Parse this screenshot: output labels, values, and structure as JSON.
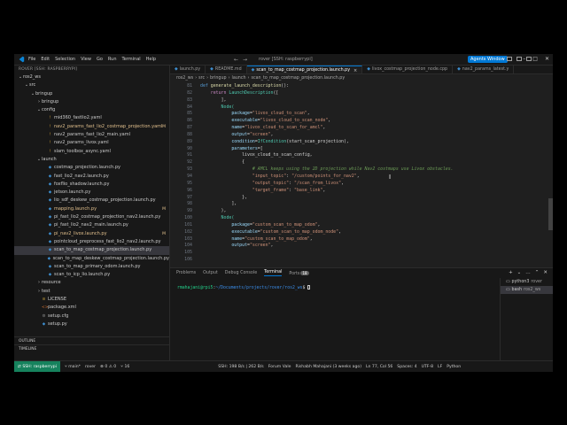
{
  "titlebar": {
    "menu": [
      "File",
      "Edit",
      "Selection",
      "View",
      "Go",
      "Run",
      "Terminal",
      "Help"
    ],
    "title": "rover [SSH: raspberrypi]",
    "agents_label": "Agents Window"
  },
  "sidebar": {
    "header": "ROVER [SSH: RASPBERRYPI]",
    "items": [
      {
        "label": "ros2_ws",
        "depth": 0,
        "chev": "⌄",
        "kind": "folder"
      },
      {
        "label": "src",
        "depth": 1,
        "chev": "⌄",
        "kind": "folder"
      },
      {
        "label": "bringup",
        "depth": 2,
        "chev": "⌄",
        "kind": "folder"
      },
      {
        "label": "bringup",
        "depth": 3,
        "chev": "›",
        "kind": "folder"
      },
      {
        "label": "config",
        "depth": 3,
        "chev": "⌄",
        "kind": "folder"
      },
      {
        "label": "mid360_fastlio2.yaml",
        "depth": 4,
        "kind": "yaml"
      },
      {
        "label": "nav2_params_fast_lio2_costmap_projection.yaml",
        "depth": 4,
        "kind": "yaml",
        "mod": "M"
      },
      {
        "label": "nav2_params_fast_lio2_main.yaml",
        "depth": 4,
        "kind": "yaml"
      },
      {
        "label": "nav2_params_livox.yaml",
        "depth": 4,
        "kind": "yaml"
      },
      {
        "label": "slam_toolbox_async.yaml",
        "depth": 4,
        "kind": "yaml"
      },
      {
        "label": "launch",
        "depth": 3,
        "chev": "⌄",
        "kind": "folder"
      },
      {
        "label": "costmap_projection.launch.py",
        "depth": 4,
        "kind": "py"
      },
      {
        "label": "fast_lio2_nav2.launch.py",
        "depth": 4,
        "kind": "py"
      },
      {
        "label": "foxflio_shadow.launch.py",
        "depth": 4,
        "kind": "py"
      },
      {
        "label": "jetson.launch.py",
        "depth": 4,
        "kind": "py"
      },
      {
        "label": "lio_sdf_deskew_costmap_projection.launch.py",
        "depth": 4,
        "kind": "py"
      },
      {
        "label": "mapping.launch.py",
        "depth": 4,
        "kind": "py",
        "mod": "M"
      },
      {
        "label": "pi_fast_lio2_costmap_projection_nav2.launch.py",
        "depth": 4,
        "kind": "py"
      },
      {
        "label": "pi_fast_lio2_nav2_main.launch.py",
        "depth": 4,
        "kind": "py"
      },
      {
        "label": "pi_nav2_livox.launch.py",
        "depth": 4,
        "kind": "py",
        "mod": "M"
      },
      {
        "label": "pointcloud_preprocess_fast_lio2_nav2.launch.py",
        "depth": 4,
        "kind": "py"
      },
      {
        "label": "scan_to_map_costmap_projection.launch.py",
        "depth": 4,
        "kind": "py",
        "selected": true
      },
      {
        "label": "scan_to_map_deskew_costmap_projection.launch.py",
        "depth": 4,
        "kind": "py"
      },
      {
        "label": "scan_to_map_primary_odom.launch.py",
        "depth": 4,
        "kind": "py"
      },
      {
        "label": "scan_to_icp_lio.launch.py",
        "depth": 4,
        "kind": "py"
      },
      {
        "label": "resource",
        "depth": 3,
        "chev": "›",
        "kind": "folder"
      },
      {
        "label": "test",
        "depth": 3,
        "chev": "›",
        "kind": "folder"
      },
      {
        "label": "LICENSE",
        "depth": 3,
        "kind": "txt"
      },
      {
        "label": "package.xml",
        "depth": 3,
        "kind": "xml"
      },
      {
        "label": "setup.cfg",
        "depth": 3,
        "kind": "cfg"
      },
      {
        "label": "setup.py",
        "depth": 3,
        "kind": "py"
      }
    ],
    "footer": [
      "OUTLINE",
      "TIMELINE"
    ]
  },
  "editor": {
    "tabs": [
      {
        "label": "launch.py",
        "active": false
      },
      {
        "label": "README.md",
        "active": false
      },
      {
        "label": "scan_to_map_costmap_projection.launch.py",
        "active": true
      },
      {
        "label": "livox_costmap_projection_node.cpp",
        "active": false
      },
      {
        "label": "nav2_params_latest.y",
        "active": false
      }
    ],
    "breadcrumb": [
      "ros2_ws",
      "src",
      "bringup",
      "launch",
      "scan_to_map_costmap_projection.launch.py"
    ],
    "line_numbers": [
      "81",
      "82",
      "83",
      "84",
      "85",
      "86",
      "87",
      "88",
      "89",
      "90",
      "91",
      "92",
      "93",
      "94",
      "95",
      "96",
      "97",
      "98",
      "99",
      "100",
      "101",
      "102",
      "103",
      "104",
      "105",
      "106"
    ],
    "lines": [
      [
        {
          "t": "def ",
          "c": "k"
        },
        {
          "t": "generate_launch_description",
          "c": "f"
        },
        {
          "t": "():",
          "c": ""
        }
      ],
      [
        {
          "t": "    return ",
          "c": "kw"
        },
        {
          "t": "LaunchDescription",
          "c": "cls"
        },
        {
          "t": "([",
          "c": ""
        }
      ],
      [
        {
          "t": "        ],",
          "c": ""
        }
      ],
      [
        {
          "t": "        Node(",
          "c": "cls"
        }
      ],
      [
        {
          "t": "            package",
          "c": "p"
        },
        {
          "t": "=",
          "c": ""
        },
        {
          "t": "\"livox_cloud_to_scan\"",
          "c": "s"
        },
        {
          "t": ",",
          "c": ""
        }
      ],
      [
        {
          "t": "            executable",
          "c": "p"
        },
        {
          "t": "=",
          "c": ""
        },
        {
          "t": "\"livox_cloud_to_scan_node\"",
          "c": "s"
        },
        {
          "t": ",",
          "c": ""
        }
      ],
      [
        {
          "t": "            name",
          "c": "p"
        },
        {
          "t": "=",
          "c": ""
        },
        {
          "t": "\"livox_cloud_to_scan_for_amcl\"",
          "c": "s"
        },
        {
          "t": ",",
          "c": ""
        }
      ],
      [
        {
          "t": "            output",
          "c": "p"
        },
        {
          "t": "=",
          "c": ""
        },
        {
          "t": "\"screen\"",
          "c": "s"
        },
        {
          "t": ",",
          "c": ""
        }
      ],
      [
        {
          "t": "            condition",
          "c": "p"
        },
        {
          "t": "=",
          "c": ""
        },
        {
          "t": "IfCondition",
          "c": "cls"
        },
        {
          "t": "(start_scan_projection),",
          "c": ""
        }
      ],
      [
        {
          "t": "            parameters",
          "c": "p"
        },
        {
          "t": "=[",
          "c": ""
        }
      ],
      [
        {
          "t": "                livox_cloud_to_scan_config,",
          "c": ""
        }
      ],
      [
        {
          "t": "                {",
          "c": ""
        }
      ],
      [
        {
          "t": "                    # AMCL keeps using the 2D projection while Nav2 costmaps use Livox obstacles.",
          "c": "c"
        }
      ],
      [
        {
          "t": "                    \"input_topic\"",
          "c": "s"
        },
        {
          "t": ": ",
          "c": ""
        },
        {
          "t": "\"/custom/points_for_nav2\"",
          "c": "s"
        },
        {
          "t": ",",
          "c": ""
        }
      ],
      [
        {
          "t": "                    \"output_topic\"",
          "c": "s"
        },
        {
          "t": ": ",
          "c": ""
        },
        {
          "t": "\"/scan_from_livox\"",
          "c": "s"
        },
        {
          "t": ",",
          "c": ""
        }
      ],
      [
        {
          "t": "                    \"target_frame\"",
          "c": "s"
        },
        {
          "t": ": ",
          "c": ""
        },
        {
          "t": "\"base_link\"",
          "c": "s"
        },
        {
          "t": ",",
          "c": ""
        }
      ],
      [
        {
          "t": "                },",
          "c": ""
        }
      ],
      [
        {
          "t": "            ],",
          "c": ""
        }
      ],
      [
        {
          "t": "        ),",
          "c": ""
        }
      ],
      [
        {
          "t": "        Node(",
          "c": "cls"
        }
      ],
      [
        {
          "t": "            package",
          "c": "p"
        },
        {
          "t": "=",
          "c": ""
        },
        {
          "t": "\"custom_scan_to_map_odom\"",
          "c": "s"
        },
        {
          "t": ",",
          "c": ""
        }
      ],
      [
        {
          "t": "            executable",
          "c": "p"
        },
        {
          "t": "=",
          "c": ""
        },
        {
          "t": "\"custom_scan_to_map_odom_node\"",
          "c": "s"
        },
        {
          "t": ",",
          "c": ""
        }
      ],
      [
        {
          "t": "            name",
          "c": "p"
        },
        {
          "t": "=",
          "c": ""
        },
        {
          "t": "\"custom_scan_to_map_odom\"",
          "c": "s"
        },
        {
          "t": ",",
          "c": ""
        }
      ],
      [
        {
          "t": "            output",
          "c": "p"
        },
        {
          "t": "=",
          "c": ""
        },
        {
          "t": "\"screen\"",
          "c": "s"
        },
        {
          "t": ",",
          "c": ""
        }
      ],
      [
        {
          "t": "",
          "c": ""
        }
      ],
      [
        {
          "t": "",
          "c": ""
        }
      ]
    ]
  },
  "panel": {
    "tabs": [
      "Problems",
      "Output",
      "Debug Console",
      "Terminal",
      "Ports"
    ],
    "ports_count": "18",
    "prompt_user": "rmahajani@rpi5",
    "prompt_path": "~/Documents/projects/rover/ros2_ws",
    "prompt_symbol": "$",
    "terminals": [
      {
        "label": "python3",
        "sub": "rover"
      },
      {
        "label": "bash",
        "sub": "ros2_ws"
      }
    ]
  },
  "status": {
    "remote": "SSH: raspberrypi",
    "branch": "main*",
    "project": "rover",
    "problems": "⊗ 0  ⚠ 0",
    "ports": "⑂ 16",
    "ssh": "SSH: 198 B/s | 262 B/s",
    "forum": "Forum Vale",
    "blame": "Rishabh Mahajani (3 weeks ago)",
    "position": "Ln 77, Col 56",
    "spaces": "Spaces: 4",
    "encoding": "UTF-8",
    "eol": "LF",
    "language": "Python"
  },
  "colors": {
    "accent": "#0078d4",
    "remote": "#16825d",
    "modified": "#e2c08d",
    "editor_bg": "#1f1f1f",
    "sidebar_bg": "#181818"
  }
}
